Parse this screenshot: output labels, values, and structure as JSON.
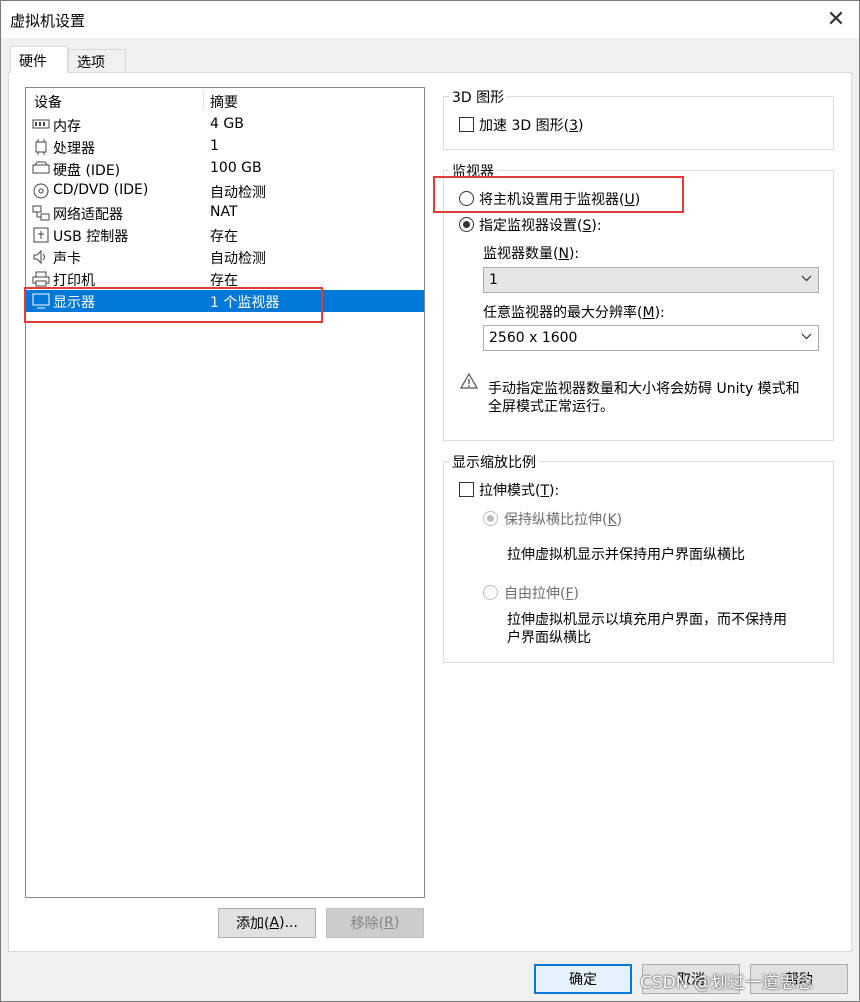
{
  "window": {
    "title": "虚拟机设置",
    "close_glyph": "✕"
  },
  "tabs": [
    {
      "label": "硬件"
    },
    {
      "label": "选项"
    }
  ],
  "devices": {
    "col_device": "设备",
    "col_summary": "摘要",
    "rows": [
      {
        "icon": "memory-icon",
        "name": "内存",
        "summary": "4 GB"
      },
      {
        "icon": "processor-icon",
        "name": "处理器",
        "summary": "1"
      },
      {
        "icon": "harddisk-icon",
        "name": "硬盘 (IDE)",
        "summary": "100 GB"
      },
      {
        "icon": "cd-dvd-icon",
        "name": "CD/DVD (IDE)",
        "summary": "自动检测"
      },
      {
        "icon": "network-adapter-icon",
        "name": "网络适配器",
        "summary": "NAT"
      },
      {
        "icon": "usb-icon",
        "name": "USB 控制器",
        "summary": "存在"
      },
      {
        "icon": "sound-card-icon",
        "name": "声卡",
        "summary": "自动检测"
      },
      {
        "icon": "printer-icon",
        "name": "打印机",
        "summary": "存在"
      },
      {
        "icon": "display-icon",
        "name": "显示器",
        "summary": "1 个监视器",
        "selected": true
      }
    ],
    "add_button": {
      "pre": "添加(",
      "key": "A",
      "post": ")..."
    },
    "remove_button": {
      "pre": "移除(",
      "key": "R",
      "post": ")"
    }
  },
  "graphics3d": {
    "title": "3D 图形",
    "accelerate": {
      "pre": "加速 3D 图形(",
      "key": "3",
      "post": ")",
      "checked": false
    }
  },
  "monitor": {
    "title": "监视器",
    "use_host": {
      "pre": "将主机设置用于监视器(",
      "key": "U",
      "post": ")",
      "selected": false
    },
    "specify": {
      "pre": "指定监视器设置(",
      "key": "S",
      "post": "):",
      "selected": true
    },
    "count_label": {
      "pre": "监视器数量(",
      "key": "N",
      "post": "):"
    },
    "count_value": "1",
    "maxres_label": {
      "pre": "任意监视器的最大分辨率(",
      "key": "M",
      "post": "):"
    },
    "maxres_value": "2560 x 1600",
    "warning_line1": "手动指定监视器数量和大小将会妨碍 Unity 模式和",
    "warning_line2": "全屏模式正常运行。"
  },
  "scaling": {
    "title": "显示缩放比例",
    "stretch": {
      "pre": "拉伸模式(",
      "key": "T",
      "post": "):",
      "checked": false
    },
    "keep_aspect": {
      "pre": "保持纵横比拉伸(",
      "key": "K",
      "post": ")",
      "selected": true
    },
    "keep_aspect_desc": "拉伸虚拟机显示并保持用户界面纵横比",
    "free_stretch": {
      "pre": "自由拉伸(",
      "key": "F",
      "post": ")",
      "selected": false
    },
    "free_desc_line1": "拉伸虚拟机显示以填充用户界面，而不保持用",
    "free_desc_line2": "户界面纵横比"
  },
  "footer": {
    "ok": "确定",
    "cancel": "取消",
    "help": "帮助"
  },
  "watermark": "CSDN @划过一道思念",
  "colors": {
    "selection": "#0078d7",
    "highlight_box": "#e03c3c"
  }
}
